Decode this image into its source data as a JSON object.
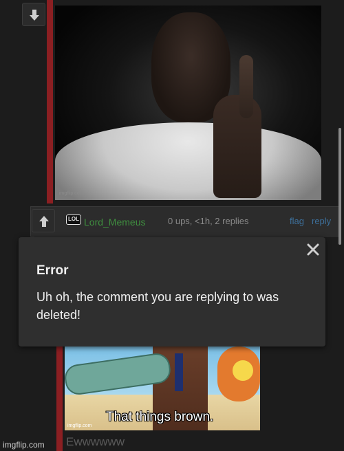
{
  "thread": {
    "comment": {
      "username": "Lord_Memeus",
      "badge": "LOL",
      "meta": "0 ups, <1h, 2 replies",
      "flag_label": "flag",
      "reply_label": "reply"
    },
    "reply_body": "Ewwwwww"
  },
  "memes": {
    "first_watermark": "imgflip.com",
    "second_watermark": "imgflip.com",
    "second_caption": "That things brown."
  },
  "dialog": {
    "title": "Error",
    "message": "Uh oh, the comment you are replying to was deleted!",
    "close_icon": "close-x-icon"
  },
  "footer": {
    "watermark": "imgflip.com"
  },
  "icons": {
    "upvote": "arrow-up-icon",
    "downvote": "arrow-down-icon"
  },
  "colors": {
    "thread_bar": "#8b1f22",
    "username": "#3f8f3f",
    "link": "#3d6f9a",
    "dialog_bg": "#2f2f2f"
  }
}
